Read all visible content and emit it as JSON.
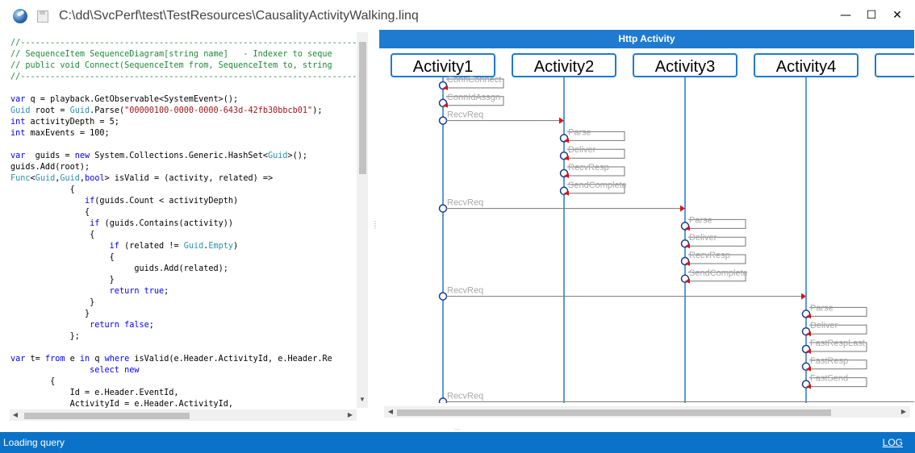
{
  "window": {
    "title": "C:\\dd\\SvcPerf\\test\\TestResources\\CausalityActivityWalking.linq",
    "minimize_glyph": "—",
    "maximize_glyph": "☐",
    "close_glyph": "✕"
  },
  "code": {
    "lines": [
      [
        {
          "c": "cm",
          "t": "//--------------------------------------------------------------------"
        }
      ],
      [
        {
          "c": "cm",
          "t": "// SequenceItem SequenceDiagram[string name]   - Indexer to seque"
        }
      ],
      [
        {
          "c": "cm",
          "t": "// public void Connect(SequenceItem from, SequenceItem to, string"
        }
      ],
      [
        {
          "c": "cm",
          "t": "//--------------------------------------------------------------------"
        }
      ],
      [
        {
          "c": "",
          "t": ""
        }
      ],
      [
        {
          "c": "kw",
          "t": "var"
        },
        {
          "c": "",
          "t": " q = playback.GetObservable<SystemEvent>();"
        }
      ],
      [
        {
          "c": "ty",
          "t": "Guid"
        },
        {
          "c": "",
          "t": " root = "
        },
        {
          "c": "ty",
          "t": "Guid"
        },
        {
          "c": "",
          "t": ".Parse("
        },
        {
          "c": "st",
          "t": "\"00000100-0000-0000-643d-42fb30bbcb01\""
        },
        {
          "c": "",
          "t": ");"
        }
      ],
      [
        {
          "c": "kw",
          "t": "int"
        },
        {
          "c": "",
          "t": " activityDepth = 5;"
        }
      ],
      [
        {
          "c": "kw",
          "t": "int"
        },
        {
          "c": "",
          "t": " maxEvents = 100;"
        }
      ],
      [
        {
          "c": "",
          "t": ""
        }
      ],
      [
        {
          "c": "kw",
          "t": "var"
        },
        {
          "c": "",
          "t": "  guids = "
        },
        {
          "c": "kw",
          "t": "new"
        },
        {
          "c": "",
          "t": " System.Collections.Generic.HashSet<"
        },
        {
          "c": "ty",
          "t": "Guid"
        },
        {
          "c": "",
          "t": ">();"
        }
      ],
      [
        {
          "c": "",
          "t": "guids.Add(root);"
        }
      ],
      [
        {
          "c": "ty",
          "t": "Func"
        },
        {
          "c": "",
          "t": "<"
        },
        {
          "c": "ty",
          "t": "Guid"
        },
        {
          "c": "",
          "t": ","
        },
        {
          "c": "ty",
          "t": "Guid"
        },
        {
          "c": "",
          "t": ","
        },
        {
          "c": "kw",
          "t": "bool"
        },
        {
          "c": "",
          "t": "> isValid = (activity, related) =>"
        }
      ],
      [
        {
          "c": "",
          "t": "            {"
        }
      ],
      [
        {
          "c": "",
          "t": "               "
        },
        {
          "c": "kw",
          "t": "if"
        },
        {
          "c": "",
          "t": "(guids.Count < activityDepth)"
        }
      ],
      [
        {
          "c": "",
          "t": "               {"
        }
      ],
      [
        {
          "c": "",
          "t": "                "
        },
        {
          "c": "kw",
          "t": "if"
        },
        {
          "c": "",
          "t": " (guids.Contains(activity))"
        }
      ],
      [
        {
          "c": "",
          "t": "                {"
        }
      ],
      [
        {
          "c": "",
          "t": "                    "
        },
        {
          "c": "kw",
          "t": "if"
        },
        {
          "c": "",
          "t": " (related != "
        },
        {
          "c": "ty",
          "t": "Guid"
        },
        {
          "c": "",
          "t": "."
        },
        {
          "c": "ty",
          "t": "Empty"
        },
        {
          "c": "",
          "t": ")"
        }
      ],
      [
        {
          "c": "",
          "t": "                    {"
        }
      ],
      [
        {
          "c": "",
          "t": "                         guids.Add(related);"
        }
      ],
      [
        {
          "c": "",
          "t": "                    }"
        }
      ],
      [
        {
          "c": "",
          "t": "                    "
        },
        {
          "c": "kw",
          "t": "return"
        },
        {
          "c": "",
          "t": " "
        },
        {
          "c": "kw",
          "t": "true"
        },
        {
          "c": "",
          "t": ";"
        }
      ],
      [
        {
          "c": "",
          "t": "                }"
        }
      ],
      [
        {
          "c": "",
          "t": "               }"
        }
      ],
      [
        {
          "c": "",
          "t": "                "
        },
        {
          "c": "kw",
          "t": "return"
        },
        {
          "c": "",
          "t": " "
        },
        {
          "c": "kw",
          "t": "false"
        },
        {
          "c": "",
          "t": ";"
        }
      ],
      [
        {
          "c": "",
          "t": "            };"
        }
      ],
      [
        {
          "c": "",
          "t": ""
        }
      ],
      [
        {
          "c": "kw",
          "t": "var"
        },
        {
          "c": "",
          "t": " t= "
        },
        {
          "c": "kw",
          "t": "from"
        },
        {
          "c": "",
          "t": " e "
        },
        {
          "c": "kw",
          "t": "in"
        },
        {
          "c": "",
          "t": " q "
        },
        {
          "c": "kw",
          "t": "where"
        },
        {
          "c": "",
          "t": " isValid(e.Header.ActivityId, e.Header.Re"
        }
      ],
      [
        {
          "c": "",
          "t": "                "
        },
        {
          "c": "kw",
          "t": "select"
        },
        {
          "c": "",
          "t": " "
        },
        {
          "c": "kw",
          "t": "new"
        }
      ],
      [
        {
          "c": "",
          "t": "        {"
        }
      ],
      [
        {
          "c": "",
          "t": "            Id = e.Header.EventId,"
        }
      ],
      [
        {
          "c": "",
          "t": "            ActivityId = e.Header.ActivityId,"
        }
      ]
    ]
  },
  "diagram": {
    "header": "Http Activity",
    "lifelines": [
      "Activity1",
      "Activity2",
      "Activity3",
      "Activity4",
      "Ac"
    ],
    "messages": [
      {
        "type": "self",
        "lane": 0,
        "label": "ConnConnect",
        "row": 0
      },
      {
        "type": "self",
        "lane": 0,
        "label": "ConnIdAssgn",
        "row": 1
      },
      {
        "type": "cross",
        "from": 0,
        "to": 1,
        "label": "RecvReq",
        "row": 2
      },
      {
        "type": "self",
        "lane": 1,
        "label": "Parse",
        "row": 3
      },
      {
        "type": "self",
        "lane": 1,
        "label": "Deliver",
        "row": 4
      },
      {
        "type": "self",
        "lane": 1,
        "label": "RecvResp",
        "row": 5
      },
      {
        "type": "self",
        "lane": 1,
        "label": "SendComplete",
        "row": 6
      },
      {
        "type": "cross",
        "from": 0,
        "to": 2,
        "label": "RecvReq",
        "row": 7
      },
      {
        "type": "self",
        "lane": 2,
        "label": "Parse",
        "row": 8
      },
      {
        "type": "self",
        "lane": 2,
        "label": "Deliver",
        "row": 9
      },
      {
        "type": "self",
        "lane": 2,
        "label": "RecvResp",
        "row": 10
      },
      {
        "type": "self",
        "lane": 2,
        "label": "SendComplete",
        "row": 11
      },
      {
        "type": "cross",
        "from": 0,
        "to": 3,
        "label": "RecvReq",
        "row": 12
      },
      {
        "type": "self",
        "lane": 3,
        "label": "Parse",
        "row": 13
      },
      {
        "type": "self",
        "lane": 3,
        "label": "Deliver",
        "row": 14
      },
      {
        "type": "self",
        "lane": 3,
        "label": "FastRespLast",
        "row": 15
      },
      {
        "type": "self",
        "lane": 3,
        "label": "FastResp",
        "row": 16
      },
      {
        "type": "self",
        "lane": 3,
        "label": "FastSend",
        "row": 17
      },
      {
        "type": "cross",
        "from": 0,
        "to": 4,
        "label": "RecvReq",
        "row": 18
      }
    ]
  },
  "status": {
    "text": "Loading query",
    "log_link": "LOG"
  },
  "colors": {
    "accent": "#0a73c9",
    "lifeline": "#1e7bd0",
    "arrowhead": "#e01010",
    "message_label": "#a8a8a8"
  }
}
